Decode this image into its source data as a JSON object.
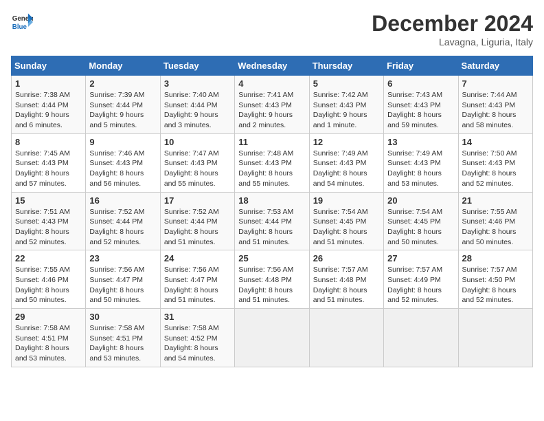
{
  "header": {
    "logo_line1": "General",
    "logo_line2": "Blue",
    "month": "December 2024",
    "location": "Lavagna, Liguria, Italy"
  },
  "weekdays": [
    "Sunday",
    "Monday",
    "Tuesday",
    "Wednesday",
    "Thursday",
    "Friday",
    "Saturday"
  ],
  "weeks": [
    [
      {
        "day": "1",
        "info": "Sunrise: 7:38 AM\nSunset: 4:44 PM\nDaylight: 9 hours\nand 6 minutes."
      },
      {
        "day": "2",
        "info": "Sunrise: 7:39 AM\nSunset: 4:44 PM\nDaylight: 9 hours\nand 5 minutes."
      },
      {
        "day": "3",
        "info": "Sunrise: 7:40 AM\nSunset: 4:44 PM\nDaylight: 9 hours\nand 3 minutes."
      },
      {
        "day": "4",
        "info": "Sunrise: 7:41 AM\nSunset: 4:43 PM\nDaylight: 9 hours\nand 2 minutes."
      },
      {
        "day": "5",
        "info": "Sunrise: 7:42 AM\nSunset: 4:43 PM\nDaylight: 9 hours\nand 1 minute."
      },
      {
        "day": "6",
        "info": "Sunrise: 7:43 AM\nSunset: 4:43 PM\nDaylight: 8 hours\nand 59 minutes."
      },
      {
        "day": "7",
        "info": "Sunrise: 7:44 AM\nSunset: 4:43 PM\nDaylight: 8 hours\nand 58 minutes."
      }
    ],
    [
      {
        "day": "8",
        "info": "Sunrise: 7:45 AM\nSunset: 4:43 PM\nDaylight: 8 hours\nand 57 minutes."
      },
      {
        "day": "9",
        "info": "Sunrise: 7:46 AM\nSunset: 4:43 PM\nDaylight: 8 hours\nand 56 minutes."
      },
      {
        "day": "10",
        "info": "Sunrise: 7:47 AM\nSunset: 4:43 PM\nDaylight: 8 hours\nand 55 minutes."
      },
      {
        "day": "11",
        "info": "Sunrise: 7:48 AM\nSunset: 4:43 PM\nDaylight: 8 hours\nand 55 minutes."
      },
      {
        "day": "12",
        "info": "Sunrise: 7:49 AM\nSunset: 4:43 PM\nDaylight: 8 hours\nand 54 minutes."
      },
      {
        "day": "13",
        "info": "Sunrise: 7:49 AM\nSunset: 4:43 PM\nDaylight: 8 hours\nand 53 minutes."
      },
      {
        "day": "14",
        "info": "Sunrise: 7:50 AM\nSunset: 4:43 PM\nDaylight: 8 hours\nand 52 minutes."
      }
    ],
    [
      {
        "day": "15",
        "info": "Sunrise: 7:51 AM\nSunset: 4:43 PM\nDaylight: 8 hours\nand 52 minutes."
      },
      {
        "day": "16",
        "info": "Sunrise: 7:52 AM\nSunset: 4:44 PM\nDaylight: 8 hours\nand 52 minutes."
      },
      {
        "day": "17",
        "info": "Sunrise: 7:52 AM\nSunset: 4:44 PM\nDaylight: 8 hours\nand 51 minutes."
      },
      {
        "day": "18",
        "info": "Sunrise: 7:53 AM\nSunset: 4:44 PM\nDaylight: 8 hours\nand 51 minutes."
      },
      {
        "day": "19",
        "info": "Sunrise: 7:54 AM\nSunset: 4:45 PM\nDaylight: 8 hours\nand 51 minutes."
      },
      {
        "day": "20",
        "info": "Sunrise: 7:54 AM\nSunset: 4:45 PM\nDaylight: 8 hours\nand 50 minutes."
      },
      {
        "day": "21",
        "info": "Sunrise: 7:55 AM\nSunset: 4:46 PM\nDaylight: 8 hours\nand 50 minutes."
      }
    ],
    [
      {
        "day": "22",
        "info": "Sunrise: 7:55 AM\nSunset: 4:46 PM\nDaylight: 8 hours\nand 50 minutes."
      },
      {
        "day": "23",
        "info": "Sunrise: 7:56 AM\nSunset: 4:47 PM\nDaylight: 8 hours\nand 50 minutes."
      },
      {
        "day": "24",
        "info": "Sunrise: 7:56 AM\nSunset: 4:47 PM\nDaylight: 8 hours\nand 51 minutes."
      },
      {
        "day": "25",
        "info": "Sunrise: 7:56 AM\nSunset: 4:48 PM\nDaylight: 8 hours\nand 51 minutes."
      },
      {
        "day": "26",
        "info": "Sunrise: 7:57 AM\nSunset: 4:48 PM\nDaylight: 8 hours\nand 51 minutes."
      },
      {
        "day": "27",
        "info": "Sunrise: 7:57 AM\nSunset: 4:49 PM\nDaylight: 8 hours\nand 52 minutes."
      },
      {
        "day": "28",
        "info": "Sunrise: 7:57 AM\nSunset: 4:50 PM\nDaylight: 8 hours\nand 52 minutes."
      }
    ],
    [
      {
        "day": "29",
        "info": "Sunrise: 7:58 AM\nSunset: 4:51 PM\nDaylight: 8 hours\nand 53 minutes."
      },
      {
        "day": "30",
        "info": "Sunrise: 7:58 AM\nSunset: 4:51 PM\nDaylight: 8 hours\nand 53 minutes."
      },
      {
        "day": "31",
        "info": "Sunrise: 7:58 AM\nSunset: 4:52 PM\nDaylight: 8 hours\nand 54 minutes."
      },
      null,
      null,
      null,
      null
    ]
  ]
}
